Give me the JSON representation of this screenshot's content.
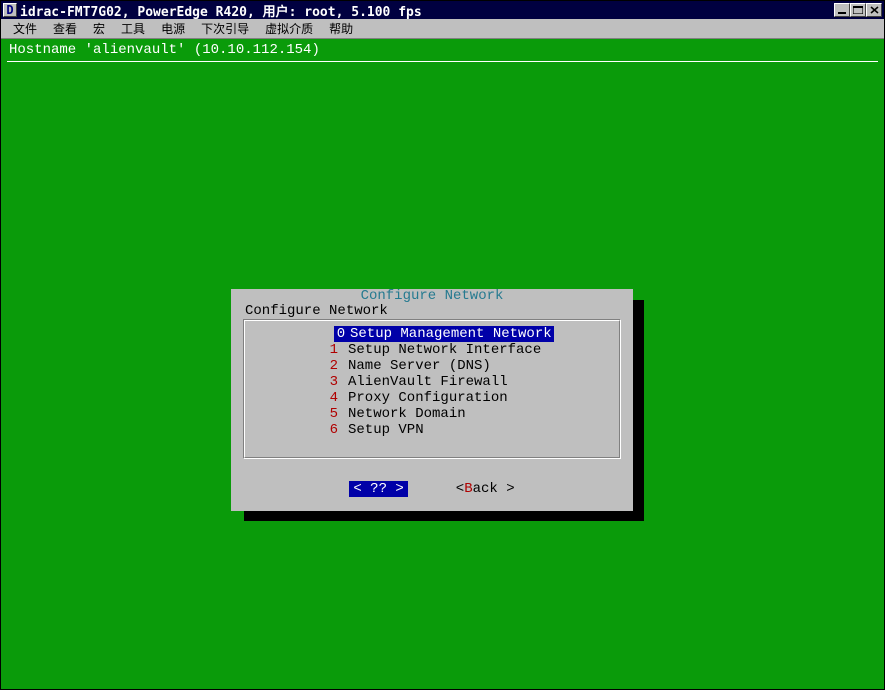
{
  "titlebar": {
    "icon_letter": "D",
    "text": "idrac-FMT7G02, PowerEdge R420, 用户: root, 5.100 fps"
  },
  "menu": {
    "items": [
      "文件",
      "查看",
      "宏",
      "工具",
      "电源",
      "下次引导",
      "虚拟介质",
      "帮助"
    ]
  },
  "console": {
    "hostname_line": "Hostname 'alienvault' (10.10.112.154)"
  },
  "dialog": {
    "title": "Configure Network",
    "inner_label": "Configure Network",
    "options": [
      {
        "num": "0",
        "label": "Setup Management Network",
        "selected": true
      },
      {
        "num": "1",
        "label": "Setup Network Interface",
        "selected": false
      },
      {
        "num": "2",
        "label": "Name Server (DNS)",
        "selected": false
      },
      {
        "num": "3",
        "label": "AlienVault Firewall",
        "selected": false
      },
      {
        "num": "4",
        "label": "Proxy Configuration",
        "selected": false
      },
      {
        "num": "5",
        "label": "Network Domain",
        "selected": false
      },
      {
        "num": "6",
        "label": "Setup VPN",
        "selected": false
      }
    ],
    "ok_label": "<   ??   >",
    "back_open": "< ",
    "back_hot": "B",
    "back_rest": "ack >"
  }
}
